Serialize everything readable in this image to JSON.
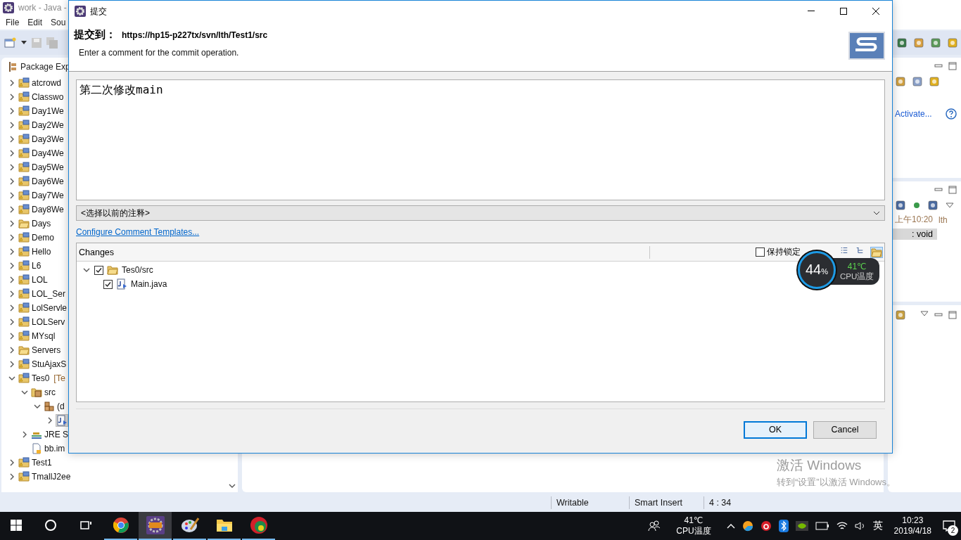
{
  "ide": {
    "title": "work - Java -",
    "menu": [
      "File",
      "Edit",
      "Sou"
    ],
    "package_explorer": {
      "title": "Package Exp",
      "tree": [
        {
          "label": "atcrowd",
          "kind": "project",
          "expanded": false,
          "selected": false
        },
        {
          "label": "Classwo",
          "kind": "project",
          "expanded": false,
          "selected": false
        },
        {
          "label": "Day1We",
          "kind": "project",
          "expanded": false,
          "selected": false
        },
        {
          "label": "Day2We",
          "kind": "project",
          "expanded": false,
          "selected": false
        },
        {
          "label": "Day3We",
          "kind": "project",
          "expanded": false,
          "selected": false
        },
        {
          "label": "Day4We",
          "kind": "project",
          "expanded": false,
          "selected": false
        },
        {
          "label": "Day5We",
          "kind": "project",
          "expanded": false,
          "selected": false
        },
        {
          "label": "Day6We",
          "kind": "project",
          "expanded": false,
          "selected": false
        },
        {
          "label": "Day7We",
          "kind": "project",
          "expanded": false,
          "selected": false
        },
        {
          "label": "Day8We",
          "kind": "project",
          "expanded": false,
          "selected": false
        },
        {
          "label": "Days",
          "kind": "folder",
          "expanded": false,
          "selected": false
        },
        {
          "label": "Demo",
          "kind": "project",
          "expanded": false,
          "selected": false
        },
        {
          "label": "Hello",
          "kind": "project",
          "expanded": false,
          "selected": false
        },
        {
          "label": "L6",
          "kind": "project",
          "expanded": false,
          "selected": false
        },
        {
          "label": "LOL",
          "kind": "project",
          "expanded": false,
          "selected": false
        },
        {
          "label": "LOL_Ser",
          "kind": "project",
          "expanded": false,
          "selected": false
        },
        {
          "label": "LolServle",
          "kind": "project",
          "expanded": false,
          "selected": false
        },
        {
          "label": "LOLServ",
          "kind": "project",
          "expanded": false,
          "selected": false
        },
        {
          "label": "MYsql",
          "kind": "project",
          "expanded": false,
          "selected": false
        },
        {
          "label": "Servers",
          "kind": "folder",
          "expanded": false,
          "selected": false
        },
        {
          "label": "StuAjaxS",
          "kind": "project",
          "expanded": false,
          "selected": false
        },
        {
          "label": "Tes0",
          "decoration": "[Te",
          "kind": "project",
          "expanded": true,
          "selected": false,
          "children": [
            {
              "label": "src",
              "kind": "source-folder",
              "expanded": true,
              "selected": false,
              "children": [
                {
                  "label": "(d",
                  "kind": "package",
                  "expanded": true,
                  "selected": false,
                  "children": [
                    {
                      "kind": "java-file",
                      "expanded": false,
                      "selected": true
                    }
                  ]
                }
              ]
            },
            {
              "label": "JRE S",
              "kind": "library",
              "expanded": false,
              "selected": false
            },
            {
              "label": "bb.im",
              "kind": "file",
              "selected": false
            }
          ]
        },
        {
          "label": "Test1",
          "kind": "project",
          "expanded": false,
          "selected": false
        },
        {
          "label": "TmallJ2ee",
          "kind": "project",
          "expanded": false,
          "selected": false
        }
      ]
    },
    "outline_panel": {
      "link": "Activate..."
    },
    "history_panel": {
      "time": "上午10:20",
      "author": "lth",
      "signature": ": void"
    },
    "status_bar": [
      "Writable",
      "Smart Insert",
      "4 : 34"
    ]
  },
  "dialog": {
    "title": "提交",
    "heading": "提交到：",
    "url": "https://hp15-p227tx/svn/lth/Test1/src",
    "subtitle": "Enter a comment for the commit operation.",
    "comment": "第二次修改main",
    "previous_comments": "<选择以前的注释>",
    "templates_link": "Configure Comment Templates...",
    "changes": {
      "title": "Changes",
      "keep_locks": {
        "label": "保持锁定",
        "checked": false
      },
      "tree": [
        {
          "label": "Tes0/src",
          "kind": "folder",
          "expanded": true,
          "checked": true,
          "children": [
            {
              "label": "Main.java",
              "kind": "java-file",
              "checked": true
            }
          ]
        }
      ]
    },
    "buttons": [
      {
        "label": "OK",
        "kind": "primary"
      },
      {
        "label": "Cancel",
        "kind": "normal"
      }
    ]
  },
  "cpu_widget": {
    "usage": "44",
    "unit": "%",
    "temperature": "41℃",
    "caption": "CPU温度"
  },
  "activation_notice": {
    "title": "激活 Windows",
    "subtitle": "转到“设置”以激活 Windows。"
  },
  "taskbar": {
    "apps": [
      {
        "kind": "browser",
        "selected": false
      },
      {
        "kind": "ide",
        "selected": true
      },
      {
        "kind": "paint",
        "selected": false
      },
      {
        "kind": "explorer",
        "selected": false
      },
      {
        "kind": "disk",
        "selected": false
      }
    ],
    "temperature": "41℃",
    "temperature_caption": "CPU温度",
    "input_language": "英",
    "time": "10:23",
    "date": "2019/4/18",
    "notifications": "2"
  }
}
